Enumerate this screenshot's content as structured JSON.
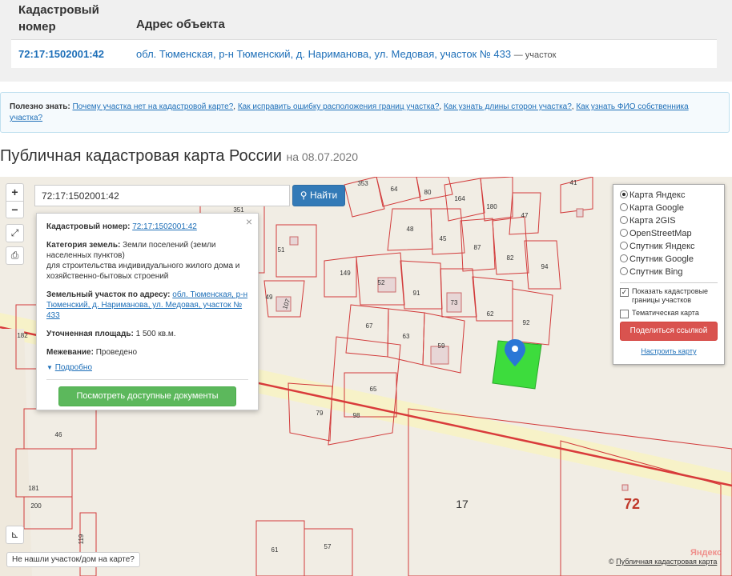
{
  "table": {
    "col1": "Кадастровый номер",
    "col2": "Адрес объекта",
    "row": {
      "number": "72:17:1502001:42",
      "address": "обл. Тюменская, р-н Тюменский, д. Нариманова, ул. Медовая, участок № 433",
      "suffix": "— участок"
    }
  },
  "info": {
    "label": "Полезно знать:",
    "links": [
      "Почему участка нет на кадастровой карте?",
      "Как исправить ошибку расположения границ участка?",
      "Как узнать длины сторон участка?",
      "Как узнать ФИО собственника участка?"
    ]
  },
  "heading": {
    "title": "Публичная кадастровая карта России",
    "date": "на 08.07.2020"
  },
  "map": {
    "search_value": "72:17:1502001:42",
    "find_label": "Найти",
    "zoom_in": "+",
    "zoom_out": "−",
    "popup": {
      "cad_label": "Кадастровый номер:",
      "cad_value": "72:17:1502001:42",
      "cat_label": "Категория земель:",
      "cat_value": "Земли поселений (земли населенных пунктов)",
      "cat_extra": "для строительства индивидуального жилого дома и хозяйственно-бытовых строений",
      "addr_label": "Земельный участок по адресу:",
      "addr_value": "обл. Тюменская, р-н Тюменский, д. Нариманова, ул. Медовая, участок № 433",
      "area_label": "Уточненная площадь:",
      "area_value": "1 500 кв.м.",
      "survey_label": "Межевание:",
      "survey_value": "Проведено",
      "more": "Подробно",
      "docs_button": "Посмотреть доступные документы"
    },
    "layers": {
      "options": [
        "Карта Яндекс",
        "Карта Google",
        "Карта 2GIS",
        "OpenStreetMap",
        "Спутник Яндекс",
        "Спутник Google",
        "Спутник Bing"
      ],
      "selected": "Карта Яндекс",
      "show_borders": "Показать кадастровые границы участков",
      "thematic": "Тематическая карта",
      "share": "Поделиться ссылкой",
      "setup": "Настроить карту"
    },
    "not_found": "Не нашли участок/дом на карте?",
    "attribution": "Публичная кадастровая карта",
    "watermark": "Яндекс",
    "plot_labels": [
      "353",
      "64",
      "80",
      "164",
      "41",
      "351",
      "180",
      "47",
      "48",
      "45",
      "87",
      "51",
      "82",
      "94",
      "149",
      "52",
      "91",
      "73",
      "49",
      "107",
      "62",
      "92",
      "182",
      "67",
      "63",
      "59",
      "65",
      "79",
      "98",
      "46",
      "181",
      "200",
      "119",
      "17",
      "72",
      "61",
      "57"
    ]
  },
  "colors": {
    "accent": "#337ab7",
    "link": "#1e6fb8",
    "share": "#d9534f",
    "docs": "#5cb85c",
    "plot_border": "#d23b3b",
    "selected_plot": "#3ddc3d"
  }
}
